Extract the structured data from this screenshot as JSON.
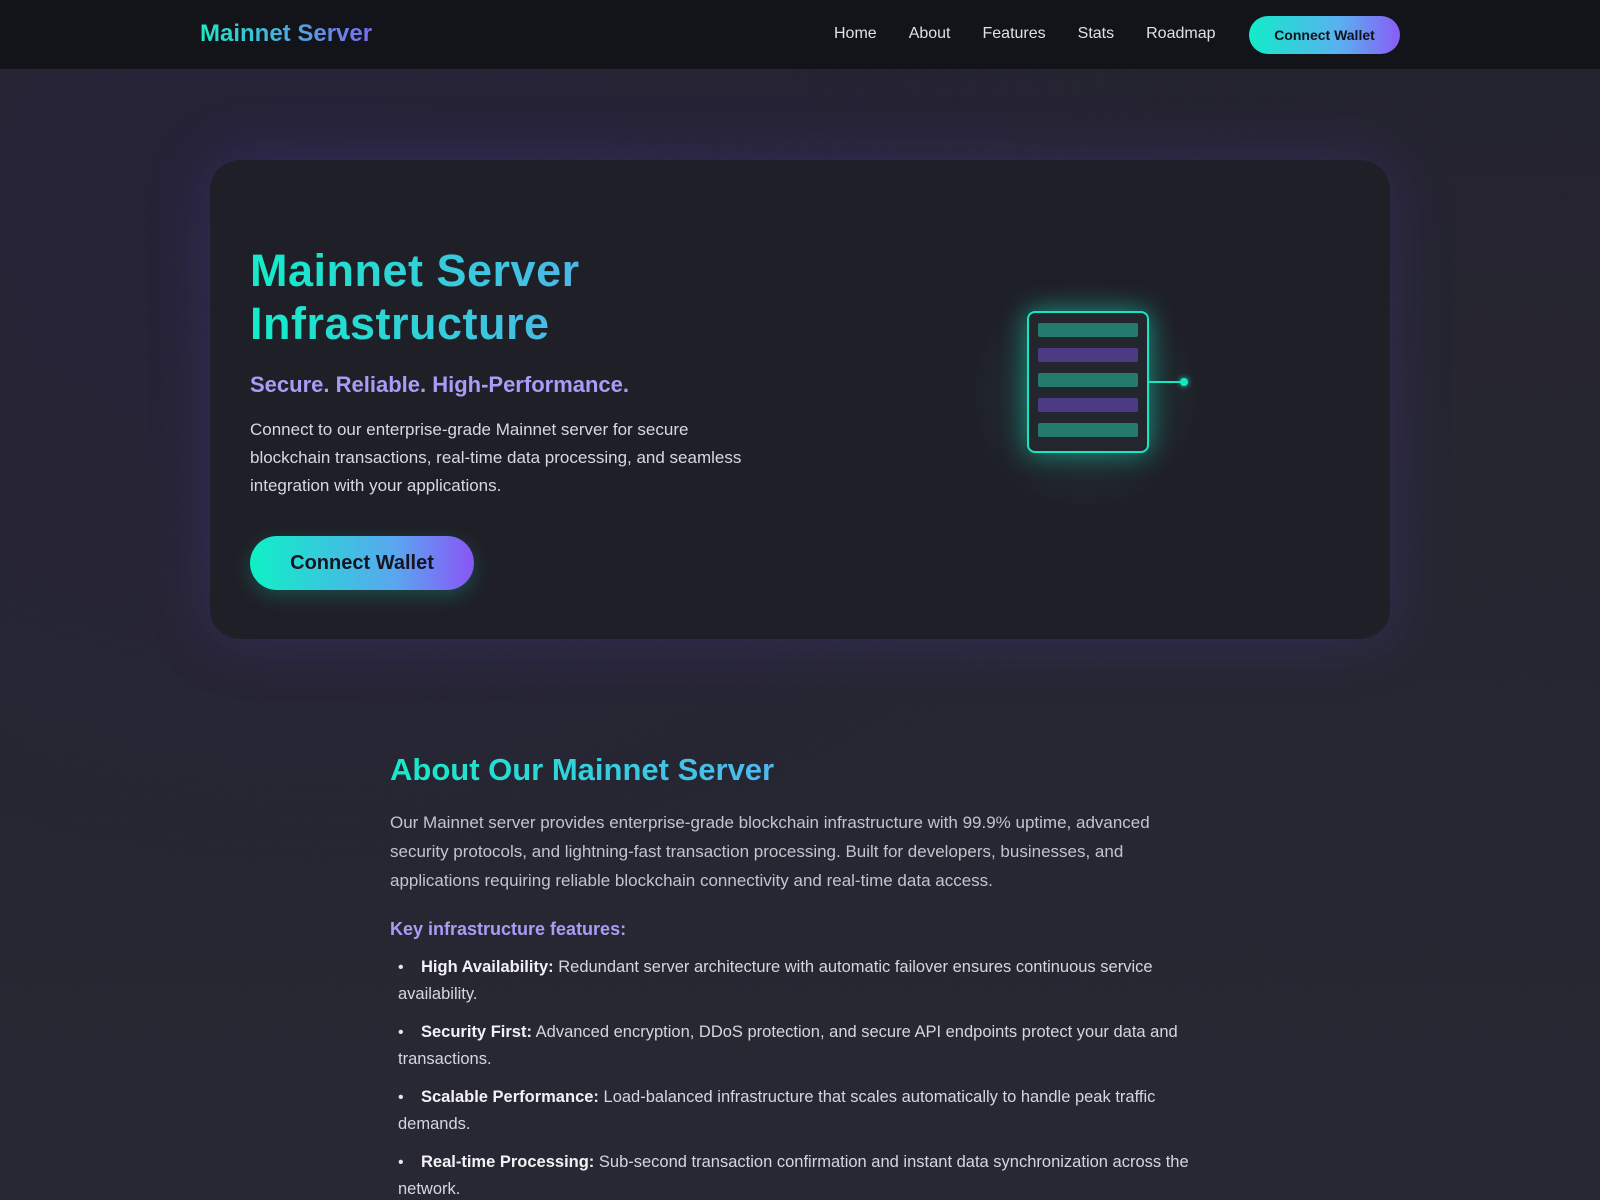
{
  "navbar": {
    "brand": "Mainnet Server",
    "links": [
      {
        "label": "Home"
      },
      {
        "label": "About"
      },
      {
        "label": "Features"
      },
      {
        "label": "Stats"
      },
      {
        "label": "Roadmap"
      }
    ],
    "connect_label": "Connect Wallet"
  },
  "hero": {
    "title_line1": "Mainnet Server",
    "title_line2": "Infrastructure",
    "subtitle": "Secure. Reliable. High-Performance.",
    "description": "Connect to our enterprise-grade Mainnet server for secure blockchain transactions, real-time data processing, and seamless integration with your applications.",
    "cta_label": "Connect Wallet",
    "illustration_icon": "server-icon"
  },
  "about": {
    "title": "About Our Mainnet Server",
    "description": "Our Mainnet server provides enterprise-grade blockchain infrastructure with 99.9% uptime, advanced security protocols, and lightning-fast transaction processing. Built for developers, businesses, and applications requiring reliable blockchain connectivity and real-time data access.",
    "features_heading": "Key infrastructure features:",
    "features": [
      {
        "label": "High Availability:",
        "text": "Redundant server architecture with automatic failover ensures continuous service availability."
      },
      {
        "label": "Security First:",
        "text": "Advanced encryption, DDoS protection, and secure API endpoints protect your data and transactions."
      },
      {
        "label": "Scalable Performance:",
        "text": "Load-balanced infrastructure that scales automatically to handle peak traffic demands."
      },
      {
        "label": "Real-time Processing:",
        "text": "Sub-second transaction confirmation and instant data synchronization across the network."
      }
    ]
  },
  "colors": {
    "accent_teal": "#16e6c2",
    "accent_purple": "#7c6cf2",
    "subtitle_lavender": "#a99cf6",
    "card_bg": "#1f2027",
    "nav_bg": "#121419"
  }
}
